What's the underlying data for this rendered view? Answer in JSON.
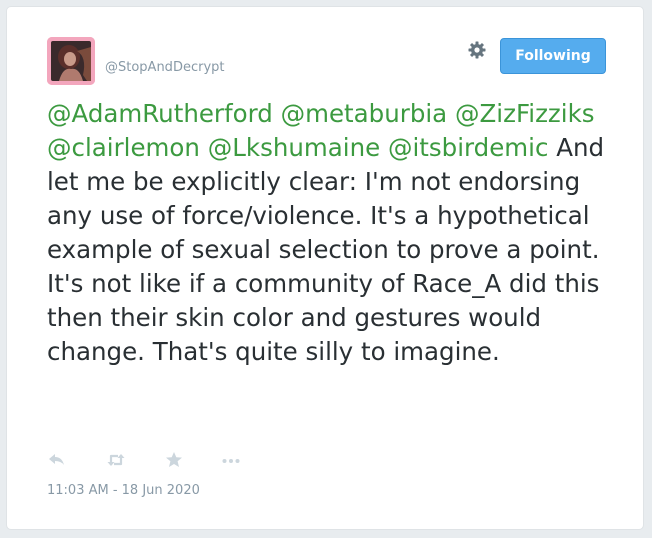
{
  "tweet": {
    "handle": "@StopAndDecrypt",
    "follow_label": "Following",
    "mentions": [
      "@AdamRutherford",
      "@metaburbia",
      "@ZizFizziks",
      "@clairlemon",
      "@Lkshumaine",
      "@itsbirdemic"
    ],
    "body": "And let me be explicitly clear: I'm not endorsing any use of force/violence. It's a hypothetical example of sexual selection to prove a point. It's not like if a community of Race_A did this then their skin color and gestures would change. That's quite silly to imagine.",
    "timestamp": "11:03 AM - 18 Jun 2020"
  },
  "icons": {
    "settings": "gear-icon",
    "reply": "reply-icon",
    "retweet": "retweet-icon",
    "like": "star-icon",
    "more": "more-icon"
  },
  "colors": {
    "mention": "#3c9a40",
    "follow_button": "#55acee",
    "muted_text": "#8899a6",
    "body_text": "#292f33"
  }
}
